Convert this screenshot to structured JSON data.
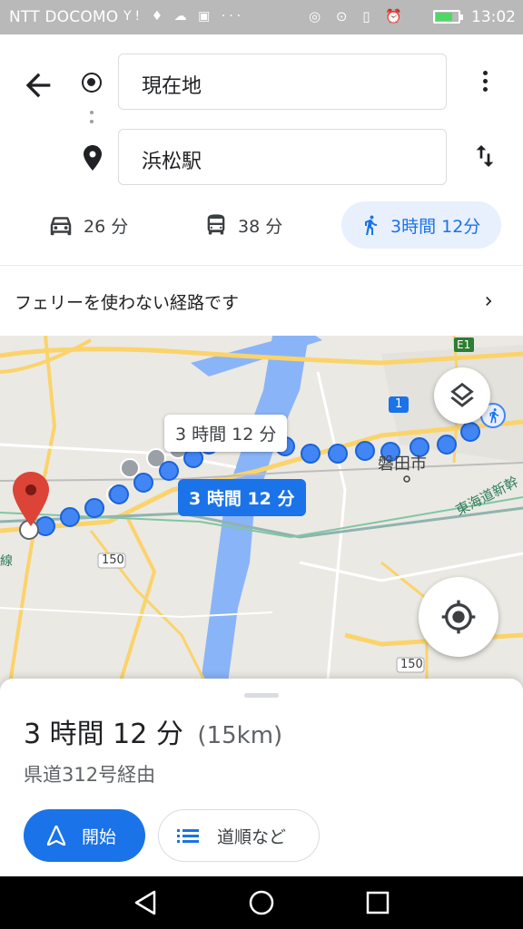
{
  "status_bar": {
    "carrier": "NTT DOCOMO",
    "left_icons_text": "Y! ♦ ☁ ▣ ···",
    "right_icons_text": "◎ ⊙ ▯ ⏰ ",
    "battery_level": 0.7,
    "time": "13:02"
  },
  "directions": {
    "origin": "現在地",
    "destination": "浜松駅",
    "modes": [
      {
        "name": "car",
        "label": "26 分",
        "icon": "car-icon"
      },
      {
        "name": "transit",
        "label": "38 分",
        "icon": "bus-icon"
      },
      {
        "name": "walk",
        "label": "3時間 12分",
        "icon": "walk-icon",
        "selected": true
      }
    ],
    "notice": "フェリーを使わない経路です"
  },
  "map": {
    "alt_route_label": "3 時間 12 分",
    "main_route_label": "3 時間 12 分",
    "place_label": "磐田市",
    "road_labels": [
      "150",
      "150",
      "1",
      "E1"
    ],
    "rail_label": "東海道新幹",
    "left_edge_label": "線"
  },
  "sheet": {
    "duration": "3 時間 12 分",
    "distance": "(15km)",
    "via": "県道312号経由",
    "start_label": "開始",
    "steps_label": "道順など"
  },
  "colors": {
    "accent": "#1a73e8",
    "selected_mode_bg": "#e8f0fe",
    "route_dot": "#4285f4",
    "alt_route_dot": "#9aa0a6",
    "destination_pin": "#db4437"
  }
}
